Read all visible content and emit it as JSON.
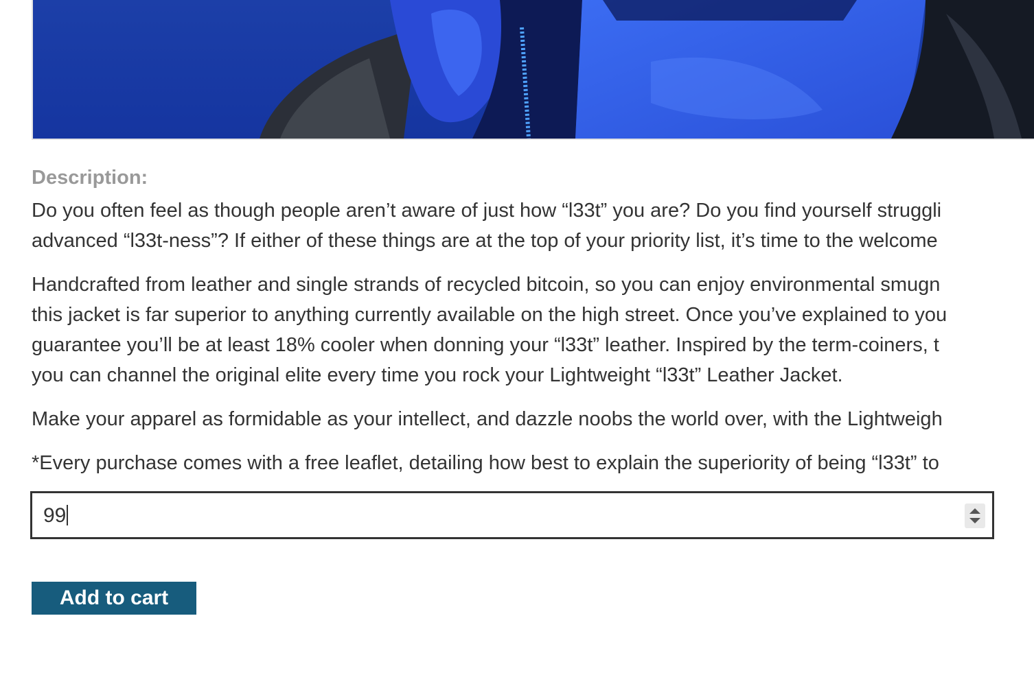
{
  "product": {
    "description_heading": "Description:",
    "paragraphs": [
      {
        "line1": "Do you often feel as though people aren’t aware of just how “l33t” you are? Do you find yourself struggli",
        "line2": "advanced “l33t-ness”? If either of these things are at the top of your priority list, it’s time to the welcome"
      },
      {
        "line1": "Handcrafted from leather and single strands of recycled bitcoin, so you can enjoy environmental smugn",
        "line2": "this jacket is far superior to anything currently available on the high street. Once you’ve explained to you",
        "line3": "guarantee you’ll be at least 18% cooler when donning your “l33t” leather. Inspired by the term-coiners, t",
        "line4": "you can channel the original elite every time you rock your Lightweight “l33t” Leather Jacket."
      },
      {
        "line1": "Make your apparel as formidable as your intellect, and dazzle noobs the world over, with the Lightweigh"
      },
      {
        "line1": "*Every purchase comes with a free leaflet, detailing how best to explain the superiority of being “l33t” to"
      }
    ]
  },
  "cart": {
    "quantity": "99",
    "add_label": "Add to cart",
    "button_color": "#175c7d"
  },
  "icons": {
    "spinner": "number-stepper-icon"
  }
}
